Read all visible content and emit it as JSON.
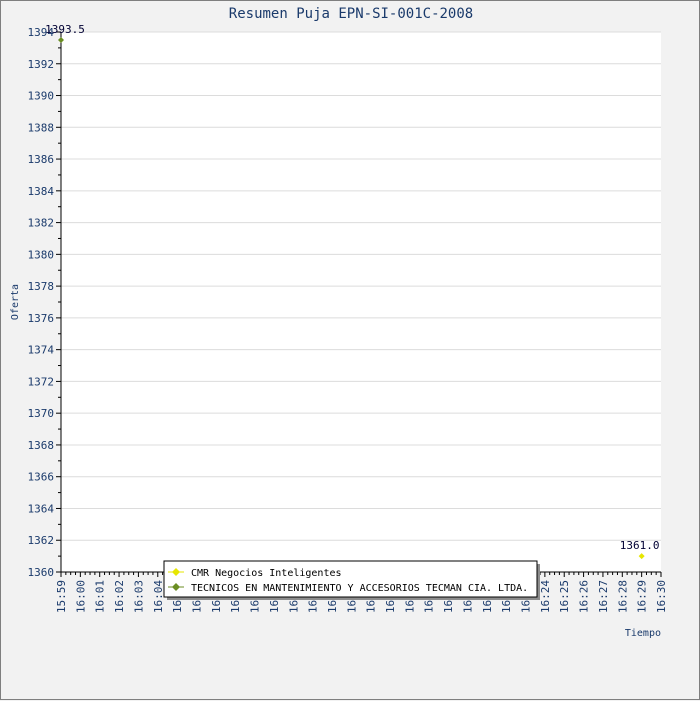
{
  "chart_data": {
    "type": "scatter",
    "title": "Resumen Puja EPN-SI-001C-2008",
    "xlabel": "Tiempo",
    "ylabel": "Oferta",
    "ylim": [
      1360,
      1394
    ],
    "y_ticks": [
      1360,
      1362,
      1364,
      1366,
      1368,
      1370,
      1372,
      1374,
      1376,
      1378,
      1380,
      1382,
      1384,
      1386,
      1388,
      1390,
      1392,
      1394
    ],
    "x_ticks": [
      "15:59",
      "16:00",
      "16:01",
      "16:02",
      "16:03",
      "16:04",
      "16:05",
      "16:06",
      "16:07",
      "16:08",
      "16:09",
      "16:10",
      "16:11",
      "16:12",
      "16:13",
      "16:14",
      "16:15",
      "16:16",
      "16:17",
      "16:18",
      "16:19",
      "16:20",
      "16:21",
      "16:22",
      "16:23",
      "16:24",
      "16:25",
      "16:26",
      "16:27",
      "16:28",
      "16:29",
      "16:30"
    ],
    "grid": true,
    "legend_position": "bottom-center",
    "series": [
      {
        "name": "CMR Negocios Inteligentes",
        "color": "#e6e600",
        "points": [
          {
            "x": "16:29",
            "y": 1361.0,
            "label": "1361.0"
          }
        ]
      },
      {
        "name": "TECNICOS EN MANTENIMIENTO Y ACCESORIOS TECMAN CIA. LTDA.",
        "color": "#6b8e23",
        "points": [
          {
            "x": "15:59",
            "y": 1393.5,
            "label": "1393.5"
          }
        ]
      }
    ]
  }
}
